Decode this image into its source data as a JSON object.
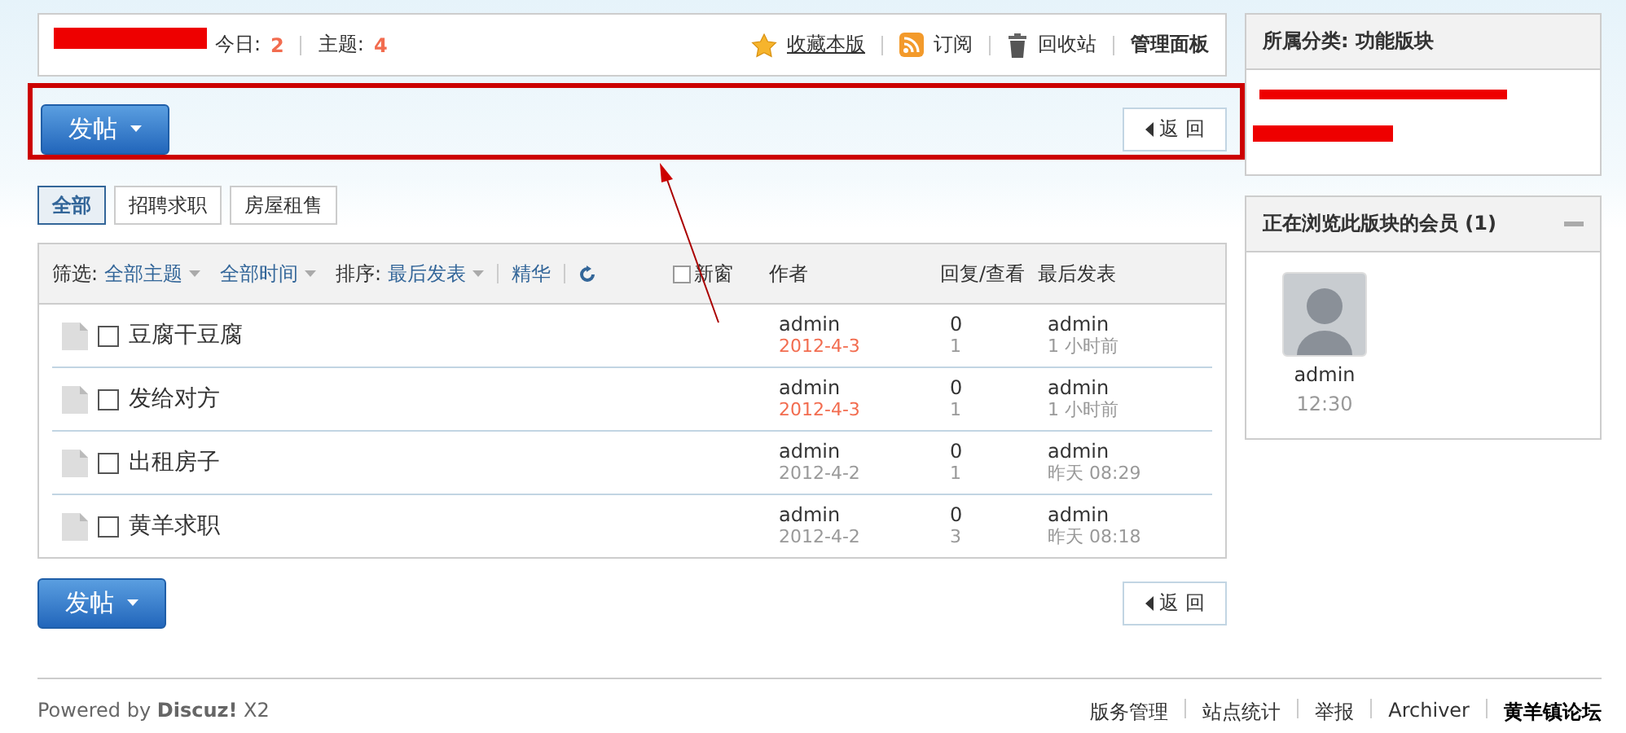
{
  "header": {
    "today_label": "今日:",
    "today": "2",
    "topics_label": "主题:",
    "topics": "4",
    "links": [
      {
        "kind": "star",
        "label": "收藏本版"
      },
      {
        "kind": "rss",
        "label": "订阅"
      },
      {
        "kind": "trash",
        "label": "回收站"
      },
      {
        "kind": "plain",
        "label": "管理面板"
      }
    ]
  },
  "toolbar": {
    "post_button": "发帖",
    "back_button": "返 回"
  },
  "type_tabs": [
    {
      "label": "全部",
      "selected": true
    },
    {
      "label": "招聘求职",
      "selected": false
    },
    {
      "label": "房屋租售",
      "selected": false
    }
  ],
  "filter": {
    "label": "筛选:",
    "options": [
      "全部主题",
      "全部时间"
    ],
    "sort_label": "排序:",
    "sort": "最后发表",
    "digest": "精华",
    "new_window": {
      "label": "新窗",
      "checked": false
    }
  },
  "columns": [
    "作者",
    "回复/查看",
    "最后发表"
  ],
  "threads": [
    {
      "title": "豆腐干豆腐",
      "checked": false,
      "author": "admin",
      "date": "2012-4-3",
      "recent": true,
      "replies": "0",
      "views": "1",
      "last_author": "admin",
      "last_time": "1 小时前"
    },
    {
      "title": "发给对方",
      "checked": false,
      "author": "admin",
      "date": "2012-4-3",
      "recent": true,
      "replies": "0",
      "views": "1",
      "last_author": "admin",
      "last_time": "1 小时前"
    },
    {
      "title": "出租房子",
      "checked": false,
      "author": "admin",
      "date": "2012-4-2",
      "recent": false,
      "replies": "0",
      "views": "1",
      "last_author": "admin",
      "last_time": "昨天 08:29"
    },
    {
      "title": "黄羊求职",
      "checked": false,
      "author": "admin",
      "date": "2012-4-2",
      "recent": false,
      "replies": "0",
      "views": "3",
      "last_author": "admin",
      "last_time": "昨天 08:18"
    }
  ],
  "bottom_toolbar": {
    "post_button": "发帖",
    "back_button": "返 回"
  },
  "footer": {
    "powered": "Powered by **Discuz!** X2",
    "links": [
      "版务管理",
      "站点统计",
      "举报",
      "Archiver"
    ],
    "site": "黄羊镇论坛"
  },
  "sidebar": {
    "category": "所属分类: 功能版块",
    "online": {
      "title": "正在浏览此版块的会员 (1)",
      "members": [
        {
          "name": "admin",
          "time": "12:30"
        }
      ]
    }
  }
}
